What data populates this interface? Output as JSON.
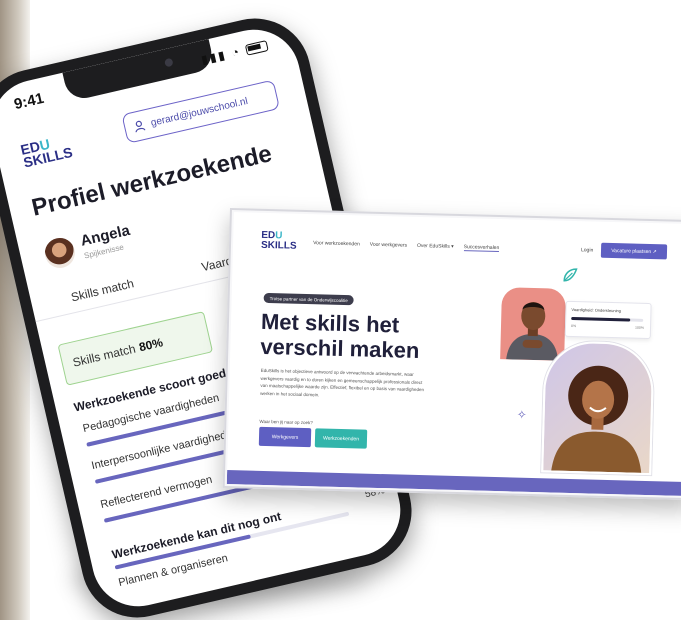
{
  "phone": {
    "status_time": "9:41",
    "logo_top": "ED",
    "logo_u": "U",
    "logo_bottom": "SKILLS",
    "account_email": "gerard@jouwschool.nl",
    "page_title": "Profiel werkzoekende",
    "user": {
      "name": "Angela",
      "role": "Spijkenisse"
    },
    "tabs": [
      "Skills match",
      "Vaardigheden"
    ],
    "skills_match": {
      "label": "Skills match",
      "value": "80%"
    },
    "good_heading": "Werkzoekende scoort goed op",
    "good_skills": [
      {
        "label": "Pedagogische vaardigheden",
        "level": 0.92
      },
      {
        "label": "Interpersoonlijke vaardigheden",
        "level": 0.88
      },
      {
        "label": "Reflecterend vermogen",
        "level": 0.86
      }
    ],
    "can_heading": "Werkzoekende kan dit nog ont",
    "can_skills": [
      {
        "label": "Plannen & organiseren",
        "percent_label": "58%",
        "level": 0.58
      }
    ]
  },
  "laptop": {
    "logo_top": "ED",
    "logo_u": "U",
    "logo_bottom": "SKILLS",
    "nav": [
      "Voor werkzoekenden",
      "Voor werkgevers",
      "Over EduSkills ▾",
      "Succesverhalen"
    ],
    "login": "Login",
    "cta_top": "Vacature plaatsen ↗",
    "badge": "Trotse partner van de Onderwijscoalitie",
    "hero_line1": "Met skills het",
    "hero_line2": "verschil maken",
    "description": "EduSkills is het objectieve antwoord op de verwachtende arbeidsmarkt, waar werkgevers vaardig en to duren kijken en gemeenschappelijk professionals direct van maatschappelijke waarde zijn. Effectief, flexibel en op basis van vaardigheden werken in het sociaal domein.",
    "choose_label": "Waar ben jij naar op zoek?",
    "button_werkgevers": "Werkgevers",
    "button_werkzoekenden": "Werkzoekenden",
    "sticker": {
      "title": "Vaardigheid: Ondersteuning",
      "min": "0%",
      "max": "100%",
      "level": 0.82
    }
  },
  "colors": {
    "accent_purple": "#6866be",
    "accent_teal": "#32b5ab",
    "brand_navy": "#2b2f86",
    "match_green": "#9ed38f"
  }
}
